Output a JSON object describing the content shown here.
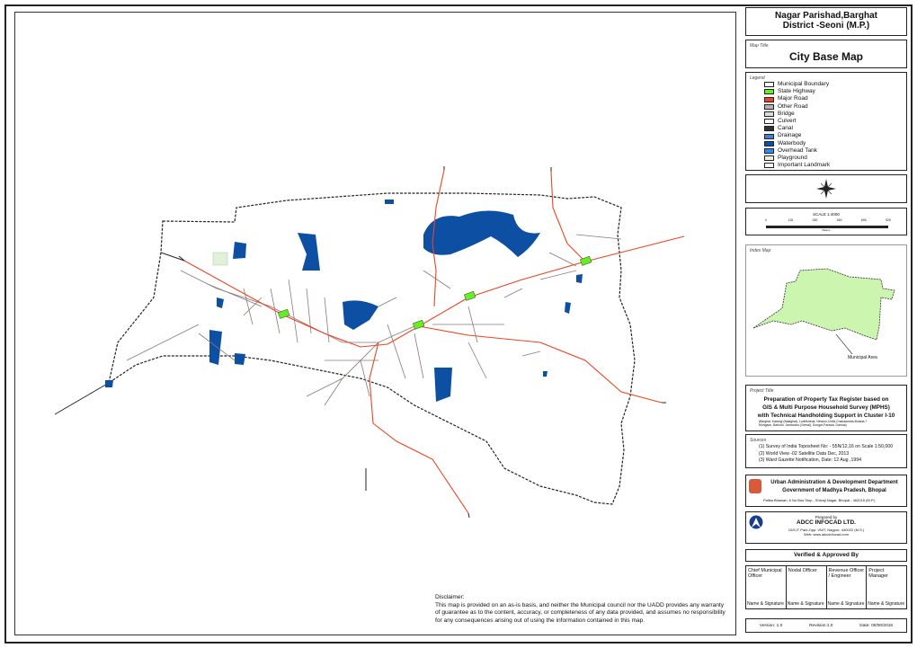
{
  "header": {
    "line1": "Nagar Parishad,Barghat",
    "line2": "District -Seoni (M.P.)"
  },
  "map_title": {
    "label": "Map Title",
    "value": "City Base Map"
  },
  "legend": {
    "label": "Legend",
    "items": [
      {
        "label": "Municipal Boundary",
        "color": "#ffffff"
      },
      {
        "label": "State Highway",
        "color": "#66ee22"
      },
      {
        "label": "Major Road",
        "color": "#ee4422"
      },
      {
        "label": "Other Road",
        "color": "#bfb0b0"
      },
      {
        "label": "Bridge",
        "color": "#dddddd"
      },
      {
        "label": "Culvert",
        "color": "#ffffff"
      },
      {
        "label": "Canal",
        "color": "#333333"
      },
      {
        "label": "Drainage",
        "color": "#4a7fd0"
      },
      {
        "label": "Waterbody",
        "color": "#0d4fa3"
      },
      {
        "label": "Overhead Tank",
        "color": "#3388ee"
      },
      {
        "label": "Playground",
        "color": "#e8f2e0"
      },
      {
        "label": "Important Landmark",
        "color": "#ffffff"
      }
    ]
  },
  "north_arrow": {
    "icon": "compass-rose-icon"
  },
  "scale": {
    "label": "SCALE 1:4000",
    "ticks": [
      "0",
      "115",
      "230",
      "460",
      "690",
      "920"
    ],
    "unit": "Meters"
  },
  "index_map": {
    "label": "Index Map",
    "area_label": "Municipal Area",
    "fill": "#ccf5b0"
  },
  "project": {
    "label": "Project Title",
    "line1": "Preparation of Property Tax Register based on",
    "line2": "GIS & Multi Purpose Household Survey (MPHS)",
    "line3": "with Technical Handholding Support in Cluster I-10",
    "towns1": "(Barghat, Katangi (Balaghat), Lodhikheda, Newton-Chikli,Chandameta-Butaria,?",
    "towns2": "Mohgaon, Barkuhi, Jamandoo (Semal), Dongar-Parasia, Damua)"
  },
  "sources": {
    "label": "Sources",
    "items": [
      "(1) Survey of India Toposheet No: - 55N/12,16 on Scale 1:50,000",
      "(2) World View -02 Satellite Data Dec, 2013",
      "(3) Ward Gazette Notification, Date: 12 Aug ,1994"
    ]
  },
  "department": {
    "line1": "Urban Administration & Development Department",
    "line2": "Government of Madhya Pradesh, Bhopal",
    "address": "Palika Bhawan, 6 No Bus Stop , Shivaji Nagar, Bhopal - 462016 (M.P.)"
  },
  "prepared": {
    "label": "Prepared by",
    "company": "ADCC INFOCAD LTD.",
    "address": "10/5,IT Park,Opp: VNIT, Nagpur- 440022 (M.S.)",
    "web": "Web: www.adccinfocad.com"
  },
  "verified": {
    "title": "Verified & Approved By",
    "columns": [
      {
        "role": "Chief Municipal Officer",
        "sign": "Name & Signature"
      },
      {
        "role": "Nodal Officer",
        "sign": "Name & Signature"
      },
      {
        "role": "Revenue Officer / Engineer",
        "sign": "Name & Signature"
      },
      {
        "role": "Project Manager",
        "sign": "Name & Signature"
      }
    ]
  },
  "version": {
    "version": "Version: 1.0",
    "revision": "Revision:1.0",
    "date": "Date: 00/00/2016"
  },
  "disclaimer": {
    "title": "Disclaimer:",
    "lines": [
      "This map is provided on an as-is basis, and neither the Municipal council nor the UADD provides any warranty",
      "of guarantee as to the content, accuracy, or completeness of any data provided, and assumes no responsibility",
      "for any consequences arising out of using  the information contained in this map."
    ]
  },
  "colors": {
    "water": "#0d4fa3",
    "major_road": "#ee4422",
    "other_road": "#8a7878",
    "highway_marker": "#66ee22",
    "boundary": "#222222"
  }
}
